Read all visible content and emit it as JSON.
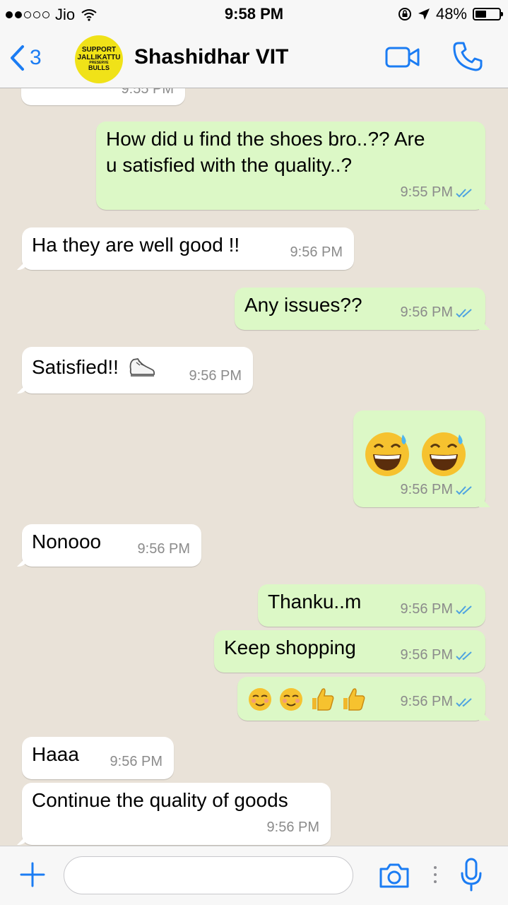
{
  "status_bar": {
    "carrier": "Jio",
    "time": "9:58 PM",
    "battery": "48%",
    "battery_level": 0.48
  },
  "header": {
    "back_count": "3",
    "contact_name": "Shashidhar VIT",
    "avatar_text": [
      "SUPPORT",
      "JALLIKATTU",
      "PRESERVE",
      "BULLS"
    ],
    "accent_color": "#1b7cf3"
  },
  "messages": [
    {
      "direction": "incoming",
      "text": "",
      "time": "9:55 PM"
    },
    {
      "direction": "outgoing",
      "lines": [
        "How did u find the shoes bro..?? Are",
        "u satisfied with the quality..?"
      ],
      "time": "9:55 PM",
      "read": true
    },
    {
      "direction": "incoming",
      "text": "Ha they are well good !!",
      "time": "9:56 PM"
    },
    {
      "direction": "outgoing",
      "text": "Any issues??",
      "time": "9:56 PM",
      "read": true
    },
    {
      "direction": "incoming",
      "text": "Satisfied!!",
      "emoji": "sneaker-emoji",
      "time": "9:56 PM"
    },
    {
      "direction": "outgoing",
      "text": "",
      "emoji": [
        "grinning-sweat-emoji",
        "grinning-sweat-emoji"
      ],
      "time": "9:56 PM",
      "read": true
    },
    {
      "direction": "incoming",
      "text": "Nonooo",
      "time": "9:56 PM"
    },
    {
      "direction": "outgoing",
      "text": "Thanku..m",
      "time": "9:56 PM",
      "read": true
    },
    {
      "direction": "outgoing",
      "text": "Keep shopping",
      "time": "9:56 PM",
      "read": true
    },
    {
      "direction": "outgoing",
      "text": "",
      "emoji": [
        "relaxed-emoji",
        "relaxed-emoji",
        "thumbs-up-emoji",
        "thumbs-up-emoji"
      ],
      "time": "9:56 PM",
      "read": true
    },
    {
      "direction": "incoming",
      "text": "Haaa",
      "time": "9:56 PM"
    },
    {
      "direction": "incoming",
      "text": "Continue the quality of goods",
      "time": "9:56 PM"
    }
  ],
  "input_bar": {
    "placeholder": ""
  },
  "colors": {
    "incoming_bubble": "#ffffff",
    "outgoing_bubble": "#dcf8c6",
    "tick_blue": "#4fa3e0",
    "chat_bg": "#e9e2d8"
  }
}
